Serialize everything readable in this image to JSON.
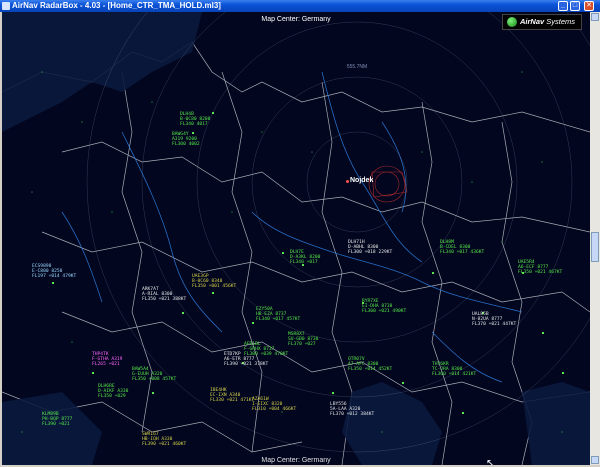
{
  "window": {
    "title": "AirNav RadarBox - 4.03 - [Home_CTR_TMA_HOLD.ml3]",
    "minimize_label": "_",
    "maximize_label": "□",
    "close_label": "✕"
  },
  "map": {
    "center_label": "Map Center: Germany",
    "city_label": "Nojdek",
    "bottom_label": "Map Center: Germany",
    "ring_label": "555.7NM"
  },
  "brand": {
    "name_bold": "AirNav",
    "name_rest": " Systems",
    "icon": "airnav-logo-icon"
  },
  "flight_tags": [
    {
      "text": "DLH4B\nB-0C80 8200\nFL340 4017",
      "color": "green"
    },
    {
      "text": "BAWG4Y\nA319 9200\nFL300 4002",
      "color": "green"
    },
    {
      "text": "ECS9898\nE-C800 8250\nFL197 +014 479KT",
      "color": "cyan"
    },
    {
      "text": "DLH7E\nD-A3KL 8200\nFL340 +017",
      "color": "green"
    },
    {
      "text": "DLH71H\nD-ABHL 8300\nFL300 +018 229KT",
      "color": "white"
    },
    {
      "text": "DLH8M\nB-CDEL 8300\nFL340 +017 436KT",
      "color": "green"
    },
    {
      "text": "ARK7AT\nA-RIAL 8300\nFL350 +021 388KT",
      "color": "white"
    },
    {
      "text": "UAE3GP\nB-0C60 8340\nFL350 +001 456KT",
      "color": "yellow"
    },
    {
      "text": "EZY50A\nHB-EZA 8737\nFL340 +017 457KT",
      "color": "green"
    },
    {
      "text": "THP4TK\nF-GTHA A319\nFL265 +021",
      "color": "magenta"
    },
    {
      "text": "BAW5A4\nG-EUUH A320\nFL350 +008 457KT",
      "color": "green"
    },
    {
      "text": "AFR1BL\nF-GRHX 8737\nFL300 +039 470KT",
      "color": "green"
    },
    {
      "text": "ETD7KP\nA6-ETR 8777\nFL390 +021 378KT",
      "color": "white"
    },
    {
      "text": "RYR7XE\nEI-DHA 8738\nFL300 +021 490KT",
      "color": "green"
    },
    {
      "text": "UAL85B\nN-82UA 8777\nFL370 +021 447KT",
      "color": "white"
    },
    {
      "text": "MSR8X7\nSU-GB0 8738\nFL370 +027",
      "color": "green"
    },
    {
      "text": "QTR07V\nA7-AFC 8300\nFL350 +014 452KT",
      "color": "green"
    },
    {
      "text": "LBY556\n5A-LAA A320\nFL370 +012 384KT",
      "color": "white"
    },
    {
      "text": "THY6KR\nTC-JRA 8300\nFL360 +014 421KT",
      "color": "green"
    },
    {
      "text": "UAE5R4\nA6-ECF 8777\nFL350 +021 467KT",
      "color": "green"
    },
    {
      "text": "AZA61W\nI-EIXC 8320\nFL310 +004 466KT",
      "color": "yellow"
    },
    {
      "text": "IBE4HK\nEC-IXN A340\nFL330 +021 471KT",
      "color": "yellow"
    },
    {
      "text": "DLH6RE\nD-AIKF A330\nFL350 +029",
      "color": "green"
    },
    {
      "text": "SWR167\nHB-IQH A330\nFL390 +021 460KT",
      "color": "yellow"
    },
    {
      "text": "KLM89B\nPH-BQP 8777\nFL390 +021",
      "color": "green"
    }
  ]
}
